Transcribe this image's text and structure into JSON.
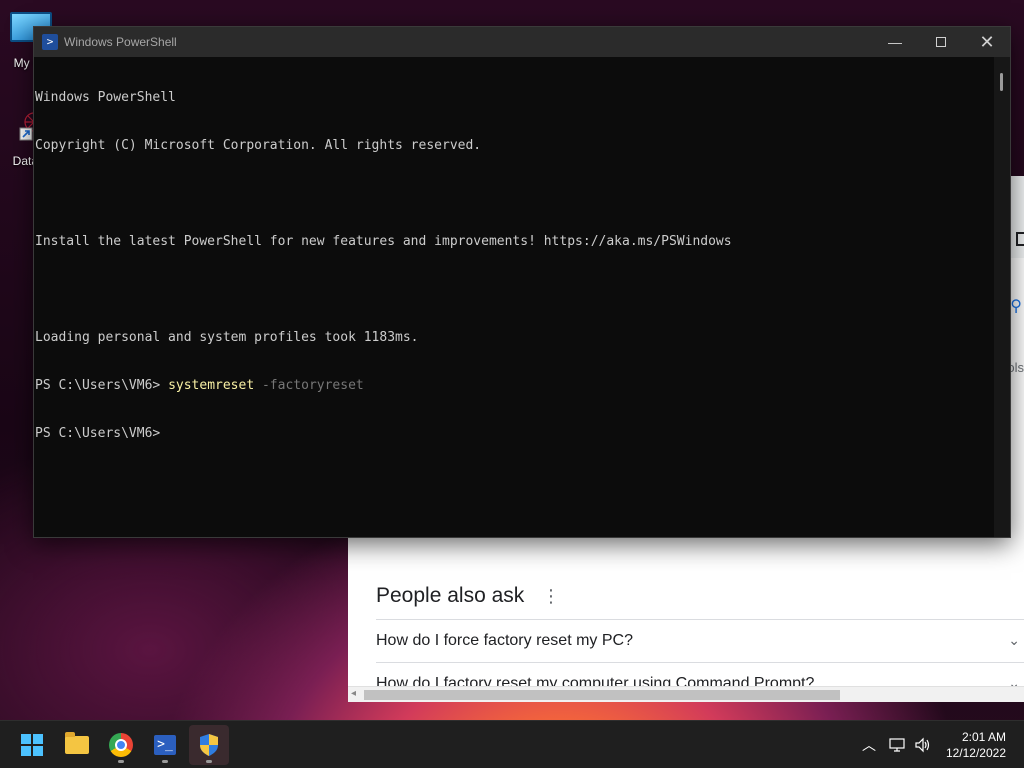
{
  "desktop": {
    "icons": [
      {
        "label": "My Co",
        "icon": "computer-icon"
      },
      {
        "label": "DataW",
        "icon": "shortcut-app-icon"
      }
    ]
  },
  "powershell": {
    "title": "Windows PowerShell",
    "lines": [
      "Windows PowerShell",
      "Copyright (C) Microsoft Corporation. All rights reserved.",
      "",
      "Install the latest PowerShell for new features and improvements! https://aka.ms/PSWindows",
      "",
      "Loading personal and system profiles took 1183ms."
    ],
    "prompt1": "PS C:\\Users\\VM6> ",
    "command": "systemreset",
    "parameter": " -factoryreset",
    "prompt2": "PS C:\\Users\\VM6>",
    "controls": {
      "minimize": "—",
      "close": "✕"
    }
  },
  "browser": {
    "people_also_ask": {
      "title": "People also ask",
      "questions": [
        "How do I force factory reset my PC?",
        "How do I factory reset my computer using Command Prompt?"
      ]
    },
    "side_text": "ols"
  },
  "taskbar": {
    "apps": [
      "start-icon",
      "file-explorer-icon",
      "chrome-icon",
      "powershell-icon",
      "security-shield-icon"
    ],
    "clock": {
      "time": "2:01 AM",
      "date": "12/12/2022"
    }
  },
  "colors": {
    "console_bg": "#0c0c0c",
    "console_text": "#cccccc",
    "command_yellow": "#f9f1a5",
    "param_gray": "#767676",
    "taskbar_bg": "#1f1f1f"
  }
}
